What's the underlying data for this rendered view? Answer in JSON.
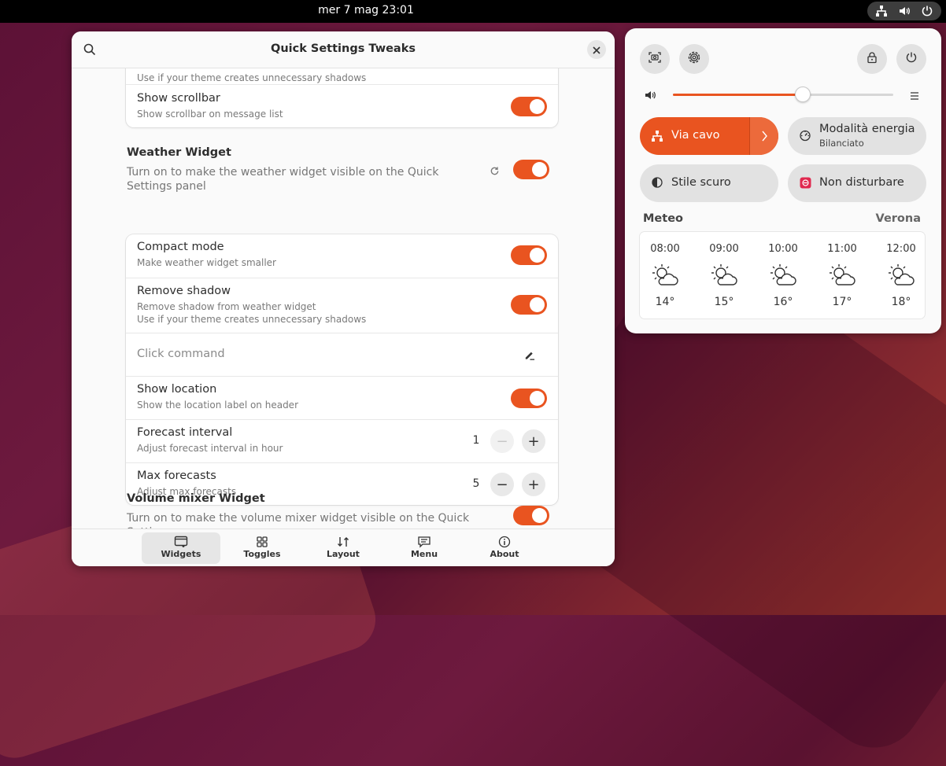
{
  "topbar": {
    "clock": "mer 7 mag  23:01"
  },
  "window": {
    "title": "Quick Settings Tweaks",
    "top_card": {
      "partial_sub": "Use if your theme creates unnecessary shadows",
      "scrollbar_title": "Show scrollbar",
      "scrollbar_sub": "Show scrollbar on message list"
    },
    "weather_section": {
      "title": "Weather Widget",
      "desc": "Turn on to make the weather widget visible on the Quick Settings panel"
    },
    "weather_rows": {
      "compact_title": "Compact mode",
      "compact_sub": "Make weather widget smaller",
      "shadow_title": "Remove shadow",
      "shadow_sub1": "Remove shadow from weather widget",
      "shadow_sub2": "Use if your theme creates unnecessary shadows",
      "click_placeholder": "Click command",
      "location_title": "Show location",
      "location_sub": "Show the location label on header",
      "interval_title": "Forecast interval",
      "interval_sub": "Adjust forecast interval in hour",
      "interval_value": "1",
      "max_title": "Max forecasts",
      "max_sub": "Adjust max forecasts",
      "max_value": "5"
    },
    "volume_section": {
      "title": "Volume mixer Widget",
      "desc": "Turn on to make the volume mixer widget visible on the Quick Settings"
    },
    "tabs": [
      {
        "label": "Widgets",
        "icon": "widgets-icon"
      },
      {
        "label": "Toggles",
        "icon": "toggles-icon"
      },
      {
        "label": "Layout",
        "icon": "layout-icon"
      },
      {
        "label": "Menu",
        "icon": "menu-icon"
      },
      {
        "label": "About",
        "icon": "about-icon"
      }
    ]
  },
  "quick_settings": {
    "volume_level": 0.59,
    "wired_label": "Via cavo",
    "power_mode_label": "Modalità energia",
    "power_mode_sub": "Bilanciato",
    "dark_style_label": "Stile scuro",
    "dnd_label": "Non disturbare",
    "meteo_label": "Meteo",
    "location": "Verona",
    "forecasts": [
      {
        "time": "08:00",
        "temp": "14°"
      },
      {
        "time": "09:00",
        "temp": "15°"
      },
      {
        "time": "10:00",
        "temp": "16°"
      },
      {
        "time": "11:00",
        "temp": "17°"
      },
      {
        "time": "12:00",
        "temp": "18°"
      }
    ]
  },
  "colors": {
    "accent": "#e95420",
    "panel": "#fafafa",
    "pill": "#e2e2e2"
  }
}
